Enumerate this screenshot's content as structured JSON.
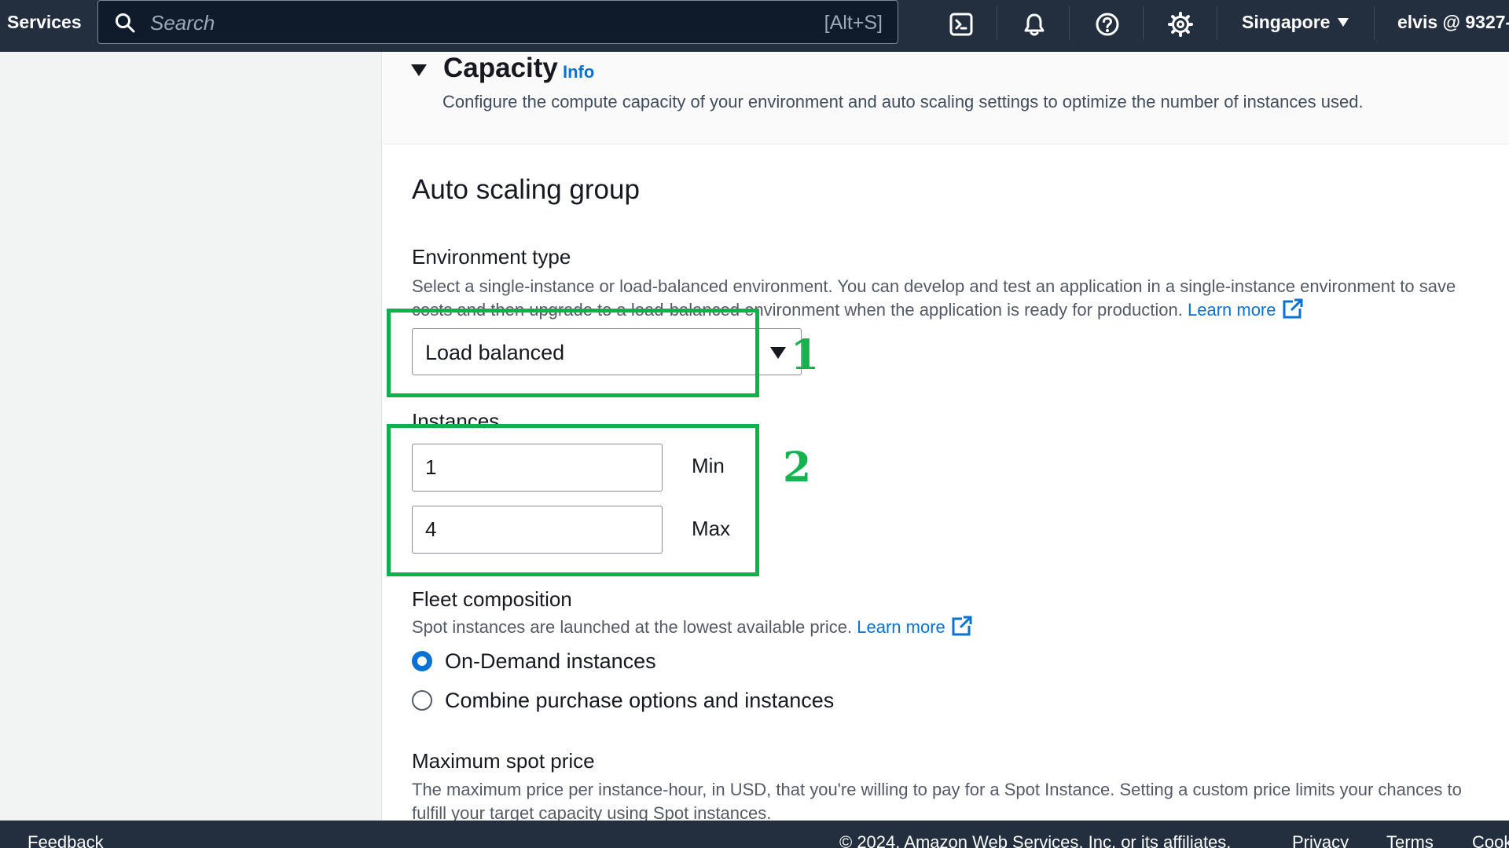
{
  "nav": {
    "services_label": "Services",
    "search_placeholder": "Search",
    "search_shortcut": "[Alt+S]",
    "icons": [
      "cloudshell-icon",
      "bell-icon",
      "help-icon",
      "gear-icon"
    ],
    "region": "Singapore",
    "account": "elvis @ 9327-"
  },
  "capacity": {
    "title": "Capacity",
    "info_label": "Info",
    "description": "Configure the compute capacity of your environment and auto scaling settings to optimize the number of instances used."
  },
  "auto_scaling": {
    "title": "Auto scaling group",
    "environment_type": {
      "label": "Environment type",
      "description": "Select a single-instance or load-balanced environment. You can develop and test an application in a single-instance environment to save costs and then upgrade to a load-balanced environment when the application is ready for production.",
      "learn_more": "Learn more",
      "selected_value": "Load balanced"
    },
    "instances": {
      "label": "Instances",
      "min_value": "1",
      "min_label": "Min",
      "max_value": "4",
      "max_label": "Max"
    },
    "fleet_composition": {
      "label": "Fleet composition",
      "description": "Spot instances are launched at the lowest available price.",
      "learn_more": "Learn more",
      "options": [
        "On-Demand instances",
        "Combine purchase options and instances"
      ],
      "selected": "On-Demand instances"
    },
    "max_spot_price": {
      "label": "Maximum spot price",
      "description": "The maximum price per instance-hour, in USD, that you're willing to pay for a Spot Instance. Setting a custom price limits your chances to fulfill your target capacity using Spot instances."
    }
  },
  "annotations": {
    "marker_1": "1",
    "marker_2": "2",
    "color": "#0fb14f"
  },
  "footer": {
    "feedback": "Feedback",
    "copyright": "© 2024, Amazon Web Services, Inc. or its affiliates.",
    "privacy": "Privacy",
    "terms": "Terms",
    "cookie": "Cookie preferences"
  },
  "colors": {
    "nav_bg": "#232f3e",
    "link": "#0972d3",
    "annotation": "#0fb14f"
  }
}
